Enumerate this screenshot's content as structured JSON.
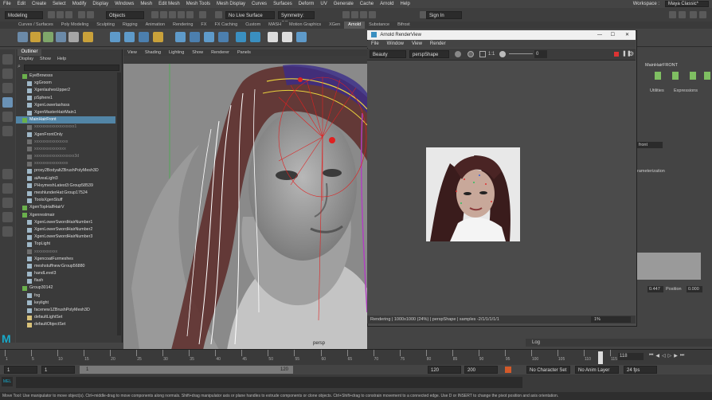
{
  "menubar": {
    "items": [
      "File",
      "Edit",
      "Create",
      "Select",
      "Modify",
      "Display",
      "Windows",
      "Mesh",
      "Edit Mesh",
      "Mesh Tools",
      "Mesh Display",
      "Curves",
      "Surfaces",
      "Deform",
      "UV",
      "Generate",
      "Cache",
      "Arnold",
      "Help"
    ],
    "workspace_label": "Workspace :",
    "workspace_value": "Maya Classic*"
  },
  "statusline": {
    "mode": "Modeling",
    "selection_mode": "Objects",
    "live_surface": "No Live Surface",
    "symmetry": "Symmetry: Off",
    "sign_in": "Sign In"
  },
  "shelf": {
    "tabs": [
      "Curves / Surfaces",
      "Poly Modeling",
      "Sculpting",
      "Rigging",
      "Animation",
      "Rendering",
      "FX",
      "FX Caching",
      "Custom",
      "MASH",
      "Motion Graphics",
      "XGen",
      "Arnold",
      "Substance",
      "Bifrost"
    ],
    "active_tab": "Arnold"
  },
  "outliner": {
    "tab": "Outliner",
    "menu": [
      "Display",
      "Show",
      "Help"
    ],
    "items": [
      {
        "label": "EyeBrowsss",
        "type": "group"
      },
      {
        "label": "xgGroom",
        "type": "node"
      },
      {
        "label": "XgenlashesUpper2",
        "type": "node"
      },
      {
        "label": "pSphere1",
        "type": "node"
      },
      {
        "label": "XgenLowerlashsss",
        "type": "node"
      },
      {
        "label": "XgenMasterHairMain1",
        "type": "node"
      },
      {
        "label": "MainHairFront",
        "type": "group",
        "selected": true
      },
      {
        "label": "xxxxxxxxxxxxxxxxxxx1",
        "type": "dim"
      },
      {
        "label": "XgenFrontOnly",
        "type": "node"
      },
      {
        "label": "xxxxxxxxxxxxxxxx",
        "type": "dim"
      },
      {
        "label": "xxxxxxxxxxxxxxx",
        "type": "dim"
      },
      {
        "label": "xxxxxxxxxxxxxxxxxxx3d",
        "type": "dim"
      },
      {
        "label": "xxxxxxxxxxxxxxxx",
        "type": "dim"
      },
      {
        "label": "proxy2BodyaltZBrushPolyMesh3D",
        "type": "node"
      },
      {
        "label": "aiAreaLight3",
        "type": "node"
      },
      {
        "label": "PHxymeshLatest3:Group58539",
        "type": "node"
      },
      {
        "label": "meshlunderHat:Group17524",
        "type": "node"
      },
      {
        "label": "ToolsXgenStuff",
        "type": "node"
      },
      {
        "label": "XgenTopHalfHairV",
        "type": "group"
      },
      {
        "label": "Xgenrestmair",
        "type": "group"
      },
      {
        "label": "XgenLowerSwordHairNumber1",
        "type": "node"
      },
      {
        "label": "XgenLowerSwordHairNumber2",
        "type": "node"
      },
      {
        "label": "XgenLowerSwordHairNumber3",
        "type": "node"
      },
      {
        "label": "TopLight",
        "type": "node"
      },
      {
        "label": "xxxxxxxxxxx",
        "type": "dim"
      },
      {
        "label": "XgencoatFurmeshes",
        "type": "node"
      },
      {
        "label": "meshstuffnew:Group56880",
        "type": "node"
      },
      {
        "label": "handLevel3",
        "type": "node"
      },
      {
        "label": "flash",
        "type": "node"
      },
      {
        "label": "Group30142",
        "type": "group"
      },
      {
        "label": "fog",
        "type": "node"
      },
      {
        "label": "keylight",
        "type": "node"
      },
      {
        "label": "facenew1ZBrushPolyMesh3D",
        "type": "node"
      },
      {
        "label": "defaultLightSet",
        "type": "set"
      },
      {
        "label": "defaultObjectSet",
        "type": "set"
      }
    ]
  },
  "viewport": {
    "menu": [
      "View",
      "Shading",
      "Lighting",
      "Show",
      "Renderer",
      "Panels"
    ],
    "camera_label": "persp"
  },
  "render_view": {
    "title": "Arnold RenderView",
    "menu": [
      "File",
      "Window",
      "View",
      "Render"
    ],
    "aov": "Beauty",
    "camera": "perspShape",
    "ratio": "1:1",
    "exposure": "0",
    "status": "Rendering | 1000x1000 (24%) | perspShape | samples -2/1/1/1/1/1",
    "zoom": "1%"
  },
  "attribute_editor": {
    "node": "MainHairFRONT",
    "tabs": [
      "Utilities",
      "Expressions"
    ],
    "field_value": "0.447",
    "position_label": "Position",
    "position_value": "0.000",
    "parameterization": "rameterization",
    "front": "front"
  },
  "timeline": {
    "ticks": [
      "1",
      "5",
      "10",
      "15",
      "20",
      "25",
      "30",
      "35",
      "40",
      "45",
      "50",
      "55",
      "60",
      "65",
      "70",
      "75",
      "80",
      "85",
      "90",
      "95",
      "100",
      "105",
      "110",
      "115"
    ],
    "current_frame": "118"
  },
  "range": {
    "start": "1",
    "start_inner": "1",
    "slider_start": "1",
    "slider_end": "120",
    "end_inner": "120",
    "end": "200",
    "character_set": "No Character Set",
    "anim_layer": "No Anim Layer",
    "fps": "24 fps"
  },
  "cmdline": {
    "lang": "MEL",
    "log_label": "Log"
  },
  "help_line": "Move Tool: Use manipulator to move object(s). Ctrl+middle-drag to move components along normals. Shift+drag manipulator axis or plane handles to extrude components or clone objects. Ctrl+Shift+drag to constrain movement to a connected edge. Use D or INSERT to change the pivot position and axis orientation."
}
